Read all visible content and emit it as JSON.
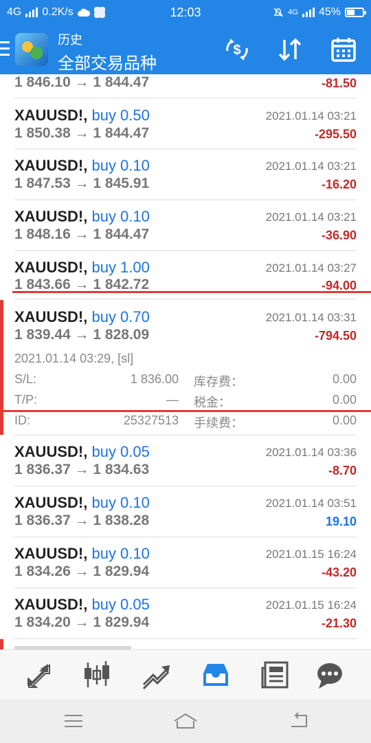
{
  "status": {
    "network": "4G",
    "speed": "0.2K/s",
    "time": "12:03",
    "network2": "4G",
    "battery": "45%",
    "battery_level": 0.45
  },
  "appbar": {
    "subtitle": "历史",
    "title": "全部交易品种"
  },
  "list": {
    "partial_top": {
      "prices": "1 846.10 → 1 844.47",
      "profit": "-81.50"
    },
    "rows": [
      {
        "symbol": "XAUUSD!,",
        "side": "buy 0.50",
        "date": "2021.01.14 03:21",
        "prices": "1 850.38 → 1 844.47",
        "profit": "-295.50"
      },
      {
        "symbol": "XAUUSD!,",
        "side": "buy 0.10",
        "date": "2021.01.14 03:21",
        "prices": "1 847.53 → 1 845.91",
        "profit": "-16.20"
      },
      {
        "symbol": "XAUUSD!,",
        "side": "buy 0.10",
        "date": "2021.01.14 03:21",
        "prices": "1 848.16 → 1 844.47",
        "profit": "-36.90"
      },
      {
        "symbol": "XAUUSD!,",
        "side": "buy 1.00",
        "date": "2021.01.14 03:27",
        "prices": "1 843.66 → 1 842.72",
        "profit": "-94.00"
      }
    ],
    "expanded": {
      "symbol": "XAUUSD!,",
      "side": "buy 0.70",
      "date": "2021.01.14 03:31",
      "prices": "1 839.44 → 1 828.09",
      "profit": "-794.50",
      "close_info": "2021.01.14 03:29, [sl]",
      "sl_label": "S/L:",
      "sl_value": "1 836.00",
      "swap_label": "库存费：",
      "swap_value": "0.00",
      "tp_label": "T/P:",
      "tp_value": "—",
      "tax_label": "税金：",
      "tax_value": "0.00",
      "id_label": "ID:",
      "id_value": "25327513",
      "fee_label": "手续费：",
      "fee_value": "0.00"
    },
    "rows2": [
      {
        "symbol": "XAUUSD!,",
        "side": "buy 0.05",
        "date": "2021.01.14 03:36",
        "prices": "1 836.37 → 1 834.63",
        "profit": "-8.70"
      },
      {
        "symbol": "XAUUSD!,",
        "side": "buy 0.10",
        "date": "2021.01.14 03:51",
        "prices": "1 836.37 → 1 838.28",
        "profit": "19.10"
      },
      {
        "symbol": "XAUUSD!,",
        "side": "buy 0.10",
        "date": "2021.01.15 16:24",
        "prices": "1 834.26 → 1 829.94",
        "profit": "-43.20"
      },
      {
        "symbol": "XAUUSD!,",
        "side": "buy 0.05",
        "date": "2021.01.15 16:24",
        "prices": "1 834.20 → 1 829.94",
        "profit": "-21.30"
      }
    ]
  },
  "bottomnav": {
    "items": [
      "quotes-icon",
      "chart-icon",
      "trade-icon",
      "history-icon",
      "news-icon",
      "chat-icon"
    ],
    "active": "history-icon",
    "active_color": "#2386e6",
    "inactive_color": "#555555"
  },
  "colors": {
    "brand": "#2386e6",
    "loss": "#c62828",
    "gain": "#1a73e8",
    "highlight": "#e53935"
  }
}
